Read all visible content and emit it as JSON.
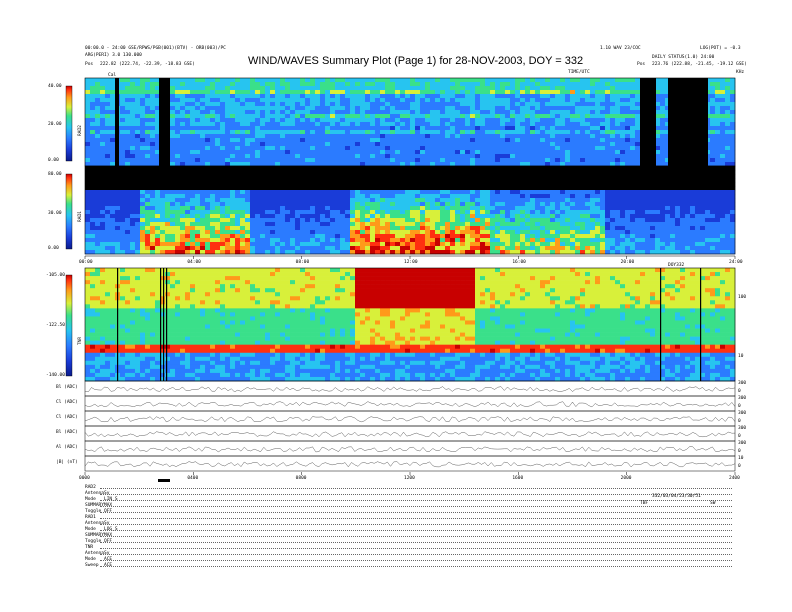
{
  "header": {
    "title": "WIND/WAVES Summary Plot (Page 1) for 28-NOV-2003, DOY = 332",
    "left_line1": "00:00.0 - 24:00 GSE/RPWS/PGB(001)(BTV) - ORB(003)/PC",
    "left_line2": "ARG(PERI) 3.0 130.000",
    "left_pos_label": "Pos",
    "left_pos_value": "222.82 (222.74, -22.39, -18.83 GSE)",
    "right_line1": "LOG(POT) = -0.3",
    "right_line2": "DAILY STATUS(1.0) 24:00",
    "right_pos_label": "Pos",
    "right_pos_value": "223.76 (222.88, -21.45, -19.12 GSE)",
    "mid_line": "1.10 WAV 23/COC",
    "time_label_center": "TIME/UTC",
    "time_label_right": "KHz"
  },
  "panels": {
    "rad2": {
      "label": "RAD2",
      "ticks": [
        "40.00",
        "20.00",
        "0.00"
      ]
    },
    "rad1": {
      "label": "RAD1",
      "ticks": [
        "80.00",
        "30.00",
        "0.00"
      ]
    },
    "tnr": {
      "label": "TNR",
      "ticks": [
        "-105.00",
        "-122.50",
        "-140.00"
      ],
      "right_ticks": [
        "100",
        "10"
      ]
    },
    "time_axis_1": {
      "ticks": [
        "00:00",
        "04:00",
        "08:00",
        "12:00",
        "16:00",
        "20:00",
        "24:00"
      ],
      "label": "DOY332"
    },
    "cal_label": "Cal"
  },
  "line_panels": [
    {
      "label": "Bl (ADC)",
      "right_ticks": [
        "300",
        "0"
      ]
    },
    {
      "label": "Cl (ADC)",
      "right_ticks": [
        "300",
        "0"
      ]
    },
    {
      "label": "Cl (ADC)",
      "right_ticks": [
        "300",
        "0"
      ]
    },
    {
      "label": "Bl (ADC)",
      "right_ticks": [
        "300",
        "0"
      ]
    },
    {
      "label": "Al (ADC)",
      "right_ticks": [
        "300",
        "0"
      ]
    },
    {
      "label": "|B| (nT)",
      "right_ticks": [
        "10",
        "0"
      ]
    }
  ],
  "time_axis_2": {
    "ticks": [
      "0000",
      "0400",
      "0800",
      "1200",
      "1600",
      "2000",
      "2400"
    ]
  },
  "footer": {
    "rad2": {
      "title": "RAD2",
      "rows": [
        [
          "Antenna",
          "Sy"
        ],
        [
          "Mode",
          "LIN_S"
        ],
        [
          "SUMMARY",
          "MAX"
        ],
        [
          "Toggle",
          "OFF"
        ]
      ]
    },
    "rad1": {
      "title": "RAD1",
      "rows": [
        [
          "Antenna",
          "Sy"
        ],
        [
          "Mode",
          "LOG_S"
        ],
        [
          "SUMMARY",
          "MAX"
        ],
        [
          "Toggle",
          "OFF"
        ]
      ]
    },
    "tnr": {
      "title": "TNR",
      "rows": [
        [
          "Antenna",
          "Sy"
        ],
        [
          "Mode",
          "ACE"
        ],
        [
          "Sweep",
          "ACE"
        ]
      ]
    },
    "right_box": {
      "line1": "332/03/04/23/30/51",
      "left": "TBF",
      "right": "SW"
    }
  },
  "colors": {
    "palette": [
      "#0a1a8c",
      "#1a3cd8",
      "#2b7bff",
      "#27c4f0",
      "#3ae08a",
      "#d8f03a",
      "#ff9a1a",
      "#ff3010",
      "#c80000"
    ],
    "background": "#ffffff"
  }
}
